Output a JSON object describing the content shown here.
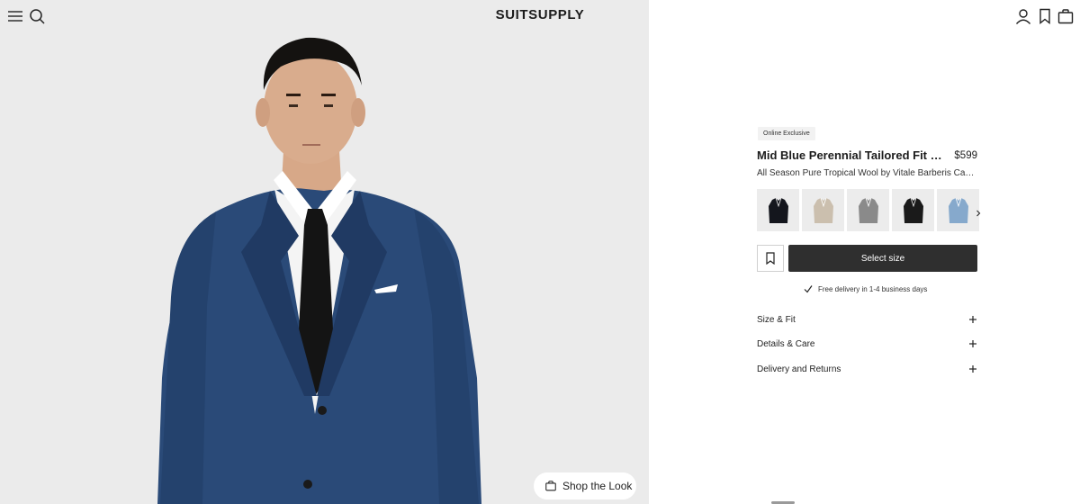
{
  "header": {
    "logo": "SUITSUPPLY",
    "icons": [
      "menu-icon",
      "search-icon",
      "account-icon",
      "bookmark-icon",
      "bag-icon"
    ]
  },
  "image_panel": {
    "shop_look_label": "Shop the Look"
  },
  "product": {
    "badge": "Online Exclusive",
    "title": "Mid Blue Perennial Tailored Fit Havana Suit",
    "price": "$599",
    "subtitle": "All Season Pure Tropical Wool by Vitale Barberis Canonico, Italy",
    "swatches": [
      {
        "name": "navy",
        "color": "#14161d"
      },
      {
        "name": "sand",
        "color": "#cbbfae"
      },
      {
        "name": "mid-grey",
        "color": "#8a8a8a"
      },
      {
        "name": "black",
        "color": "#1a1a1a"
      },
      {
        "name": "light-blue",
        "color": "#86a9cc"
      }
    ],
    "select_size_label": "Select size",
    "delivery_text": "Free delivery in 1-4 business days",
    "accordion": [
      {
        "label": "Size & Fit"
      },
      {
        "label": "Details & Care"
      },
      {
        "label": "Delivery and Returns"
      }
    ]
  },
  "colors": {
    "image_bg": "#ebebeb",
    "suit": "#2a4a78",
    "button_dark": "#2f2f2f"
  }
}
